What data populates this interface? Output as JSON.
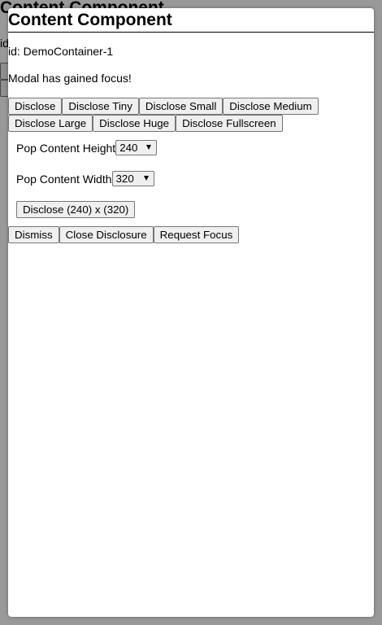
{
  "background": {
    "title": "Content Component",
    "id_text": "id"
  },
  "modal": {
    "title": "Content Component",
    "id_line": "id: DemoContainer-1",
    "focus_message": "Modal has gained focus!",
    "size_buttons": [
      "Disclose",
      "Disclose Tiny",
      "Disclose Small",
      "Disclose Medium",
      "Disclose Large",
      "Disclose Huge",
      "Disclose Fullscreen"
    ],
    "height_select": {
      "label": "Pop Content Height",
      "value": "240"
    },
    "width_select": {
      "label": "Pop Content Width",
      "value": "320"
    },
    "custom_disclose_label": "Disclose (240) x (320)",
    "action_buttons": [
      "Dismiss",
      "Close Disclosure",
      "Request Focus"
    ]
  }
}
